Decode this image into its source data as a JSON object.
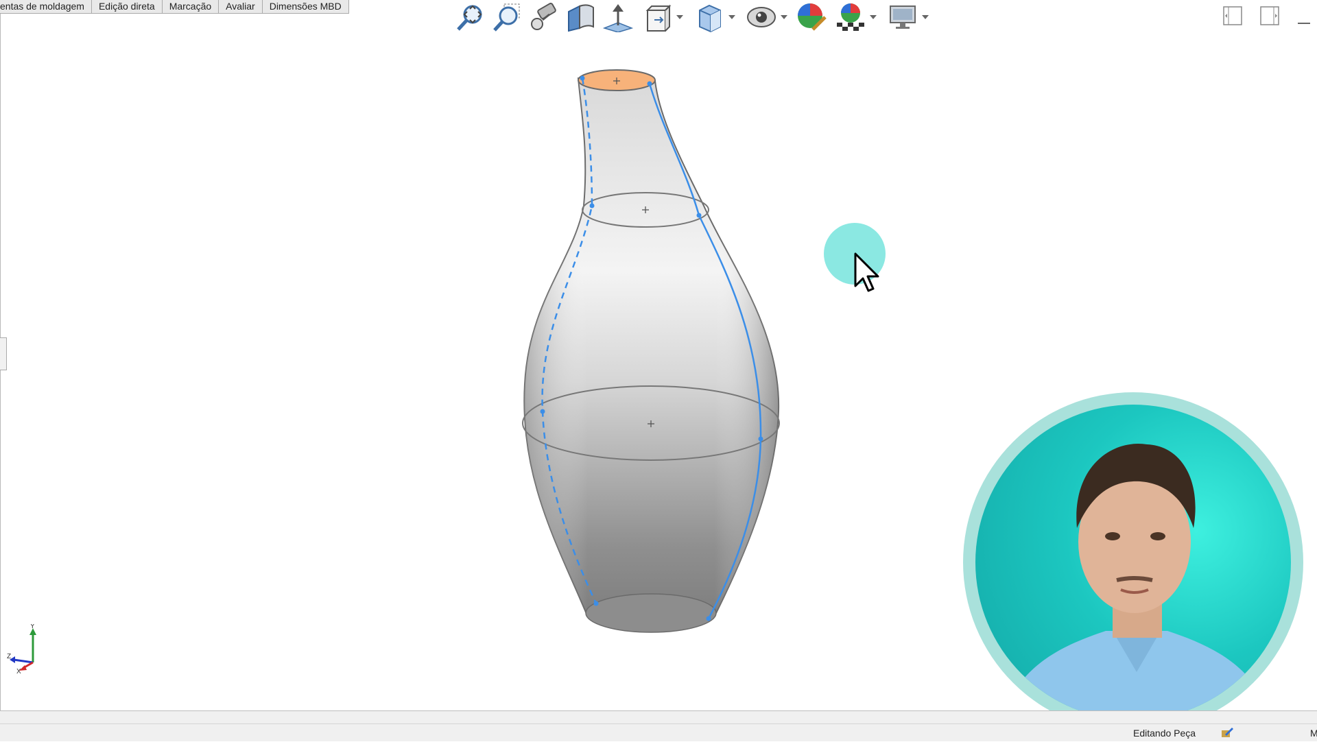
{
  "menu_tabs": [
    "entas de moldagem",
    "Edição direta",
    "Marcação",
    "Avaliar",
    "Dimensões MBD"
  ],
  "toolbar_icons": [
    "zoom-to-fit-icon",
    "zoom-to-area-icon",
    "previous-view-icon",
    "section-view-icon",
    "dynamic-annotation-icon",
    "view-orientation-icon",
    "display-style-icon",
    "hide-show-items-icon",
    "edit-appearance-icon",
    "apply-scene-icon",
    "view-settings-icon"
  ],
  "status": {
    "mode_text": "Editando Peça",
    "right_text": "M"
  },
  "axes": {
    "y": "Y",
    "z": "Z",
    "x": "X"
  },
  "colors": {
    "selected_face": "#f7b27a",
    "sketch_blue": "#3b8ee8",
    "cursor_highlight": "#7ee6df"
  }
}
